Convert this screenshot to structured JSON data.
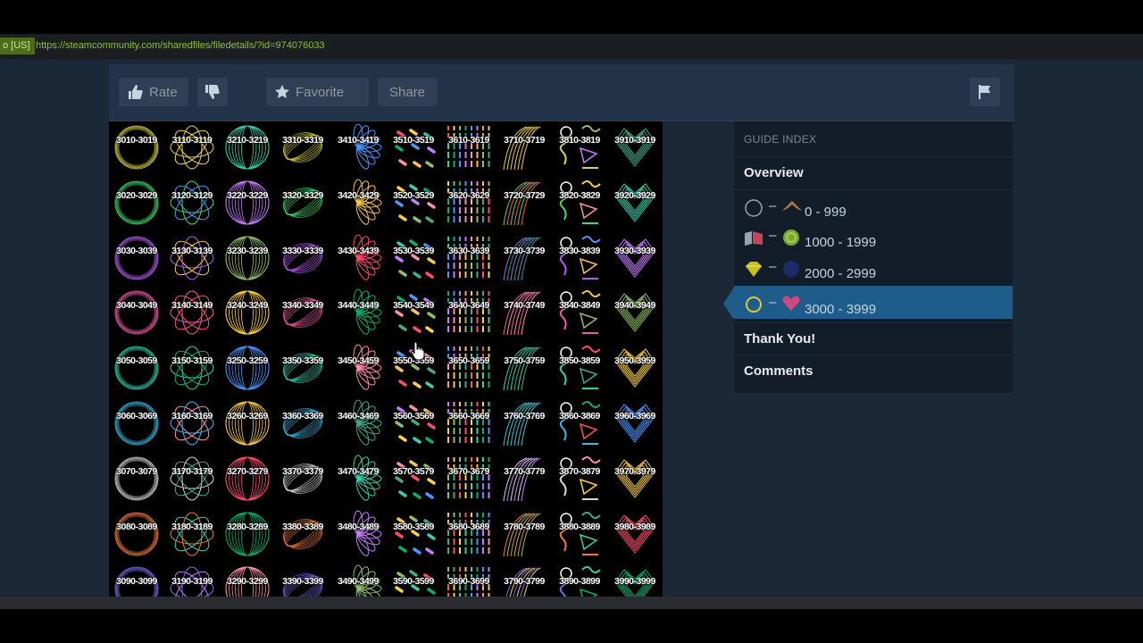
{
  "browser": {
    "url_tag": "o [US]",
    "url": "https://steamcommunity.com/sharedfiles/filedetails/?id=974076033"
  },
  "toolbar": {
    "rate_label": "Rate",
    "favorite_label": "Favorite",
    "share_label": "Share"
  },
  "grid": {
    "rows": [
      [
        "3010-3019",
        "3110-3119",
        "3210-3219",
        "3310-3319",
        "3410-3419",
        "3510-3519",
        "3610-3619",
        "3710-3719",
        "3810-3819",
        "3910-3919"
      ],
      [
        "3020-3029",
        "3120-3129",
        "3220-3229",
        "3320-3329",
        "3420-3429",
        "3520-3529",
        "3620-3629",
        "3720-3729",
        "3820-3829",
        "3920-3929"
      ],
      [
        "3030-3039",
        "3130-3139",
        "3230-3239",
        "3330-3339",
        "3430-3439",
        "3530-3539",
        "3630-3639",
        "3730-3739",
        "3830-3839",
        "3930-3939"
      ],
      [
        "3040-3049",
        "3140-3149",
        "3240-3249",
        "3340-3349",
        "3440-3449",
        "3540-3549",
        "3640-3649",
        "3740-3749",
        "3840-3849",
        "3940-3949"
      ],
      [
        "3050-3059",
        "3150-3159",
        "3250-3259",
        "3350-3359",
        "3450-3459",
        "3550-3559",
        "3650-3659",
        "3750-3759",
        "3850-3859",
        "3950-3959"
      ],
      [
        "3060-3069",
        "3160-3169",
        "3260-3269",
        "3360-3369",
        "3460-3469",
        "3560-3569",
        "3660-3669",
        "3760-3769",
        "3860-3869",
        "3960-3969"
      ],
      [
        "3070-3079",
        "3170-3179",
        "3270-3279",
        "3370-3379",
        "3470-3479",
        "3570-3579",
        "3670-3679",
        "3770-3779",
        "3870-3879",
        "3970-3979"
      ],
      [
        "3080-3089",
        "3180-3189",
        "3280-3289",
        "3380-3389",
        "3480-3489",
        "3580-3589",
        "3680-3689",
        "3780-3789",
        "3880-3889",
        "3980-3989"
      ],
      [
        "3090-3099",
        "3190-3199",
        "3290-3299",
        "3390-3399",
        "3490-3499",
        "3590-3599",
        "3690-3699",
        "3790-3799",
        "3890-3899",
        "3990-3999"
      ]
    ],
    "row_colors": [
      "#d9d24a",
      "#3fdc6a",
      "#b45cf0",
      "#f05aa8",
      "#33d0b0",
      "#3ab8e8",
      "#d8d8d8",
      "#f07a3a",
      "#7a6cf0"
    ],
    "column_styles": [
      "ring",
      "knot",
      "sphere",
      "swirl",
      "flower",
      "dashes",
      "bars",
      "waves",
      "squiggle",
      "heart"
    ]
  },
  "guide_index": {
    "title": "GUIDE INDEX",
    "overview": "Overview",
    "sections": [
      {
        "dash": "–",
        "range": "0 - 999",
        "icon_a": "circle-outline-icon",
        "icon_b": "bird-icon"
      },
      {
        "dash": "–",
        "range": "1000 - 1999",
        "icon_a": "flag-shape-icon",
        "icon_b": "green-ball-icon"
      },
      {
        "dash": "–",
        "range": "2000 - 2999",
        "icon_a": "gem-icon",
        "icon_b": "blue-ball-icon"
      },
      {
        "dash": "–",
        "range": "3000 - 3999",
        "icon_a": "gold-ring-icon",
        "icon_b": "pink-heart-icon"
      }
    ],
    "thank_you": "Thank You!",
    "comments": "Comments"
  },
  "colors": {
    "page_bg": "#1b2838",
    "toolbar_bg": "#223349",
    "active_section": "#1e5c8a"
  }
}
